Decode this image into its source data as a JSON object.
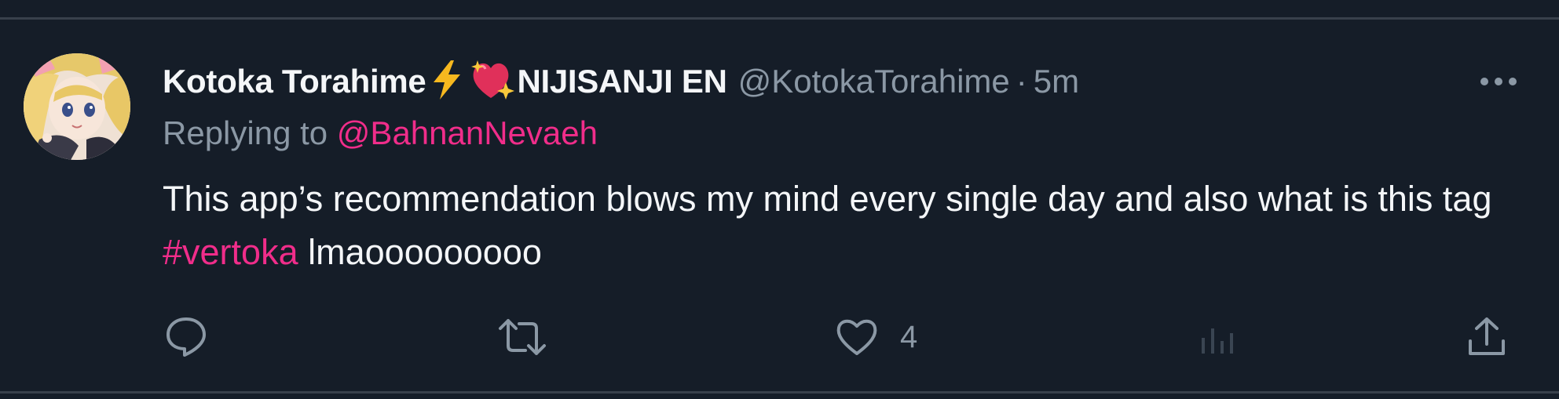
{
  "tweet": {
    "display_name_part1": "Kotoka Torahime",
    "display_name_part2": "NIJISANJI EN",
    "handle": "@KotokaTorahime",
    "separator": "·",
    "time": "5m",
    "reply_prefix": "Replying to",
    "reply_mention": "@BahnanNevaeh",
    "body_text_1": "This app’s recommendation blows my mind every single day and also what is this tag",
    "hashtag": "#vertoka",
    "body_text_2": "lmaooooooooo"
  },
  "actions": {
    "reply_icon": "reply-icon",
    "retweet_icon": "retweet-icon",
    "like_icon": "heart-icon",
    "like_count": "4",
    "views_icon": "views-icon",
    "share_icon": "share-icon"
  },
  "colors": {
    "background": "#151d28",
    "primary_text": "#f4f6f8",
    "secondary_text": "#8b98a5",
    "accent": "#f02d8a",
    "divider": "#38404b"
  }
}
